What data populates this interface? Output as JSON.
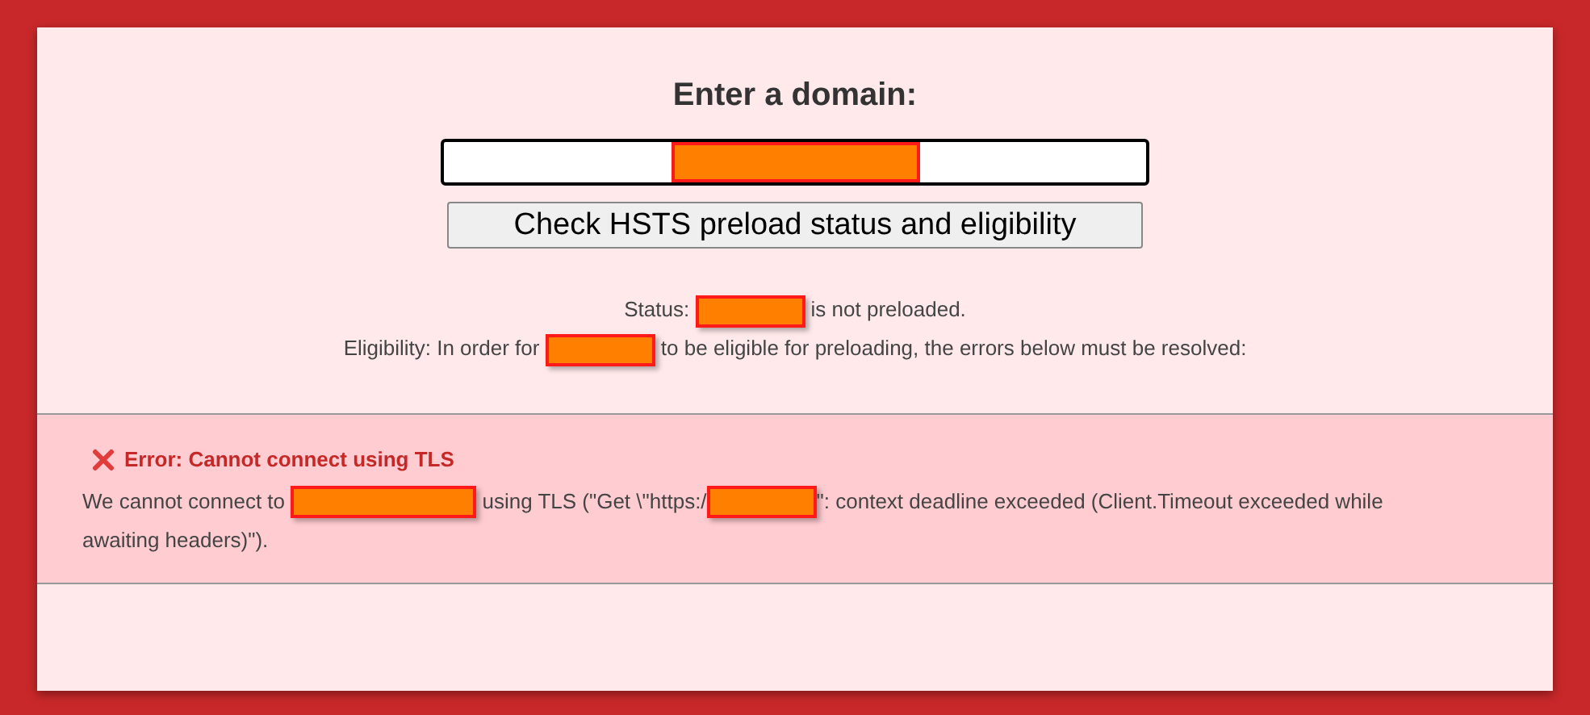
{
  "heading": "Enter a domain:",
  "domain_field": {
    "value_redacted": true
  },
  "check_button": "Check HSTS preload status and eligibility",
  "status_lines": [
    {
      "segments": [
        {
          "kind": "text",
          "text": "Status: "
        },
        {
          "kind": "redaction"
        },
        {
          "kind": "text",
          "text": " is not preloaded."
        }
      ]
    },
    {
      "segments": [
        {
          "kind": "text",
          "text": "Eligibility: In order for "
        },
        {
          "kind": "redaction"
        },
        {
          "kind": "text",
          "text": " to be eligible for preloading, the errors below must be resolved:"
        }
      ]
    }
  ],
  "errors": [
    {
      "title": "Error: Cannot connect using TLS",
      "lines": [
        {
          "segments": [
            {
              "kind": "text",
              "text": "We cannot connect to "
            },
            {
              "kind": "wide_redaction"
            },
            {
              "kind": "text",
              "text": " using TLS (\"Get \\\"https:/"
            },
            {
              "kind": "redaction"
            },
            {
              "kind": "text",
              "text": "\": context deadline exceeded (Client.Timeout exceeded while"
            }
          ]
        },
        {
          "segments": [
            {
              "kind": "text",
              "text": "awaiting headers)\")."
            }
          ]
        }
      ]
    }
  ]
}
